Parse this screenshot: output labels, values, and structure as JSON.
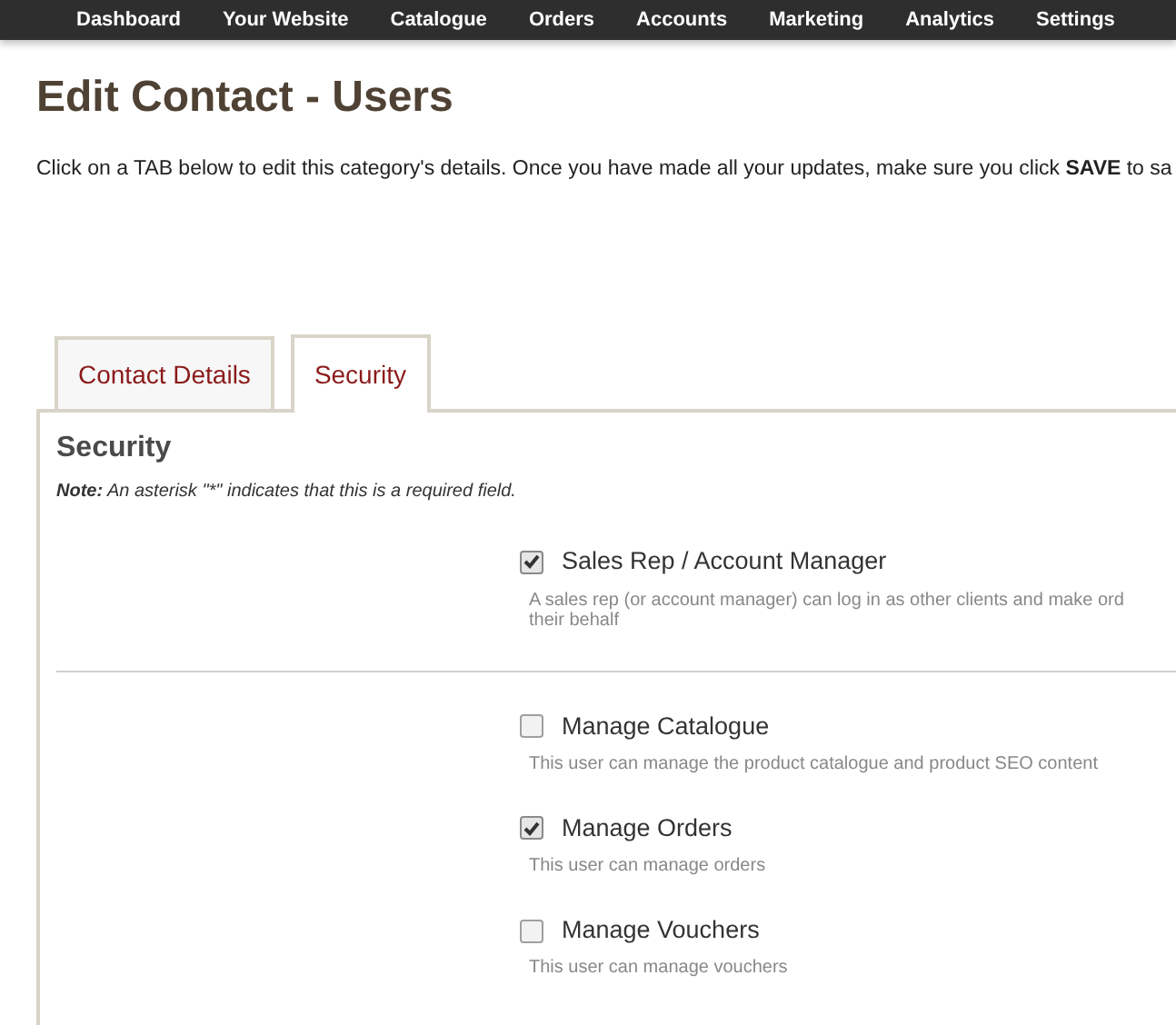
{
  "nav": [
    "Dashboard",
    "Your Website",
    "Catalogue",
    "Orders",
    "Accounts",
    "Marketing",
    "Analytics",
    "Settings"
  ],
  "title": "Edit Contact - Users",
  "intro": "Click on a TAB below to edit this category's details. Once you have made all your updates, make sure you click **SAVE** to sa",
  "tabs": [
    {
      "label": "Contact Details",
      "selected": false
    },
    {
      "label": "Security",
      "selected": true
    }
  ],
  "section": {
    "heading": "Security",
    "note": "**Note:** An asterisk \"*\" indicates that this is a required field."
  },
  "groups": [
    [
      {
        "label": "Sales Rep / Account Manager",
        "checked": true,
        "description": [
          "A sales rep (or account manager) can log in as other clients and make ord",
          "their behalf"
        ]
      }
    ],
    [
      {
        "label": "Manage Catalogue",
        "checked": false,
        "description": [
          "This user can manage the product catalogue and product SEO content"
        ]
      },
      {
        "label": "Manage Orders",
        "checked": true,
        "description": [
          "This user can manage orders"
        ]
      },
      {
        "label": "Manage Vouchers",
        "checked": false,
        "description": [
          "This user can manage vouchers"
        ]
      }
    ]
  ]
}
